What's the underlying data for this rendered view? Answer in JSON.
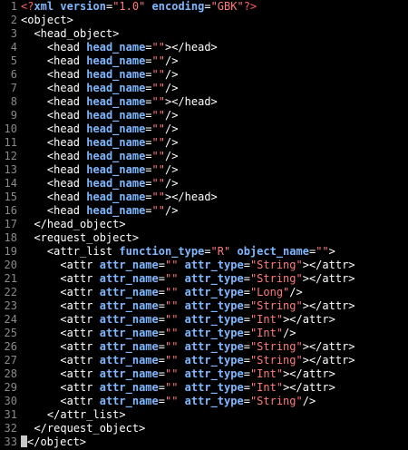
{
  "editor": {
    "lines": [
      {
        "n": "1",
        "indent": "",
        "tokens": [
          [
            "pi",
            "<?"
          ],
          [
            "attr",
            "xml"
          ],
          [
            "tag",
            " "
          ],
          [
            "attr",
            "version"
          ],
          [
            "eq",
            "="
          ],
          [
            "val",
            "\"1.0\""
          ],
          [
            "tag",
            " "
          ],
          [
            "attr",
            "encoding"
          ],
          [
            "eq",
            "="
          ],
          [
            "val",
            "\"GBK\""
          ],
          [
            "pi",
            "?>"
          ]
        ]
      },
      {
        "n": "2",
        "indent": "",
        "tokens": [
          [
            "tag",
            "<object>"
          ]
        ]
      },
      {
        "n": "3",
        "indent": "  ",
        "tokens": [
          [
            "tag",
            "<head_object>"
          ]
        ]
      },
      {
        "n": "4",
        "indent": "    ",
        "tokens": [
          [
            "tag",
            "<head "
          ],
          [
            "attr",
            "head_name"
          ],
          [
            "eq",
            "="
          ],
          [
            "val",
            "\"\""
          ],
          [
            "tag",
            "></head>"
          ]
        ]
      },
      {
        "n": "5",
        "indent": "    ",
        "tokens": [
          [
            "tag",
            "<head "
          ],
          [
            "attr",
            "head_name"
          ],
          [
            "eq",
            "="
          ],
          [
            "val",
            "\"\""
          ],
          [
            "tag",
            "/>"
          ]
        ]
      },
      {
        "n": "6",
        "indent": "    ",
        "tokens": [
          [
            "tag",
            "<head "
          ],
          [
            "attr",
            "head_name"
          ],
          [
            "eq",
            "="
          ],
          [
            "val",
            "\"\""
          ],
          [
            "tag",
            "/>"
          ]
        ]
      },
      {
        "n": "7",
        "indent": "    ",
        "tokens": [
          [
            "tag",
            "<head "
          ],
          [
            "attr",
            "head_name"
          ],
          [
            "eq",
            "="
          ],
          [
            "val",
            "\"\""
          ],
          [
            "tag",
            "/>"
          ]
        ]
      },
      {
        "n": "8",
        "indent": "    ",
        "tokens": [
          [
            "tag",
            "<head "
          ],
          [
            "attr",
            "head_name"
          ],
          [
            "eq",
            "="
          ],
          [
            "val",
            "\"\""
          ],
          [
            "tag",
            "></head>"
          ]
        ]
      },
      {
        "n": "9",
        "indent": "    ",
        "tokens": [
          [
            "tag",
            "<head "
          ],
          [
            "attr",
            "head_name"
          ],
          [
            "eq",
            "="
          ],
          [
            "val",
            "\"\""
          ],
          [
            "tag",
            "/>"
          ]
        ]
      },
      {
        "n": "10",
        "indent": "    ",
        "tokens": [
          [
            "tag",
            "<head "
          ],
          [
            "attr",
            "head_name"
          ],
          [
            "eq",
            "="
          ],
          [
            "val",
            "\"\""
          ],
          [
            "tag",
            "/>"
          ]
        ]
      },
      {
        "n": "11",
        "indent": "    ",
        "tokens": [
          [
            "tag",
            "<head "
          ],
          [
            "attr",
            "head_name"
          ],
          [
            "eq",
            "="
          ],
          [
            "val",
            "\"\""
          ],
          [
            "tag",
            "/>"
          ]
        ]
      },
      {
        "n": "12",
        "indent": "    ",
        "tokens": [
          [
            "tag",
            "<head "
          ],
          [
            "attr",
            "head_name"
          ],
          [
            "eq",
            "="
          ],
          [
            "val",
            "\"\""
          ],
          [
            "tag",
            "/>"
          ]
        ]
      },
      {
        "n": "13",
        "indent": "    ",
        "tokens": [
          [
            "tag",
            "<head "
          ],
          [
            "attr",
            "head_name"
          ],
          [
            "eq",
            "="
          ],
          [
            "val",
            "\"\""
          ],
          [
            "tag",
            "/>"
          ]
        ]
      },
      {
        "n": "14",
        "indent": "    ",
        "tokens": [
          [
            "tag",
            "<head "
          ],
          [
            "attr",
            "head_name"
          ],
          [
            "eq",
            "="
          ],
          [
            "val",
            "\"\""
          ],
          [
            "tag",
            "/>"
          ]
        ]
      },
      {
        "n": "15",
        "indent": "    ",
        "tokens": [
          [
            "tag",
            "<head "
          ],
          [
            "attr",
            "head_name"
          ],
          [
            "eq",
            "="
          ],
          [
            "val",
            "\"\""
          ],
          [
            "tag",
            "></head>"
          ]
        ]
      },
      {
        "n": "16",
        "indent": "    ",
        "tokens": [
          [
            "tag",
            "<head "
          ],
          [
            "attr",
            "head_name"
          ],
          [
            "eq",
            "="
          ],
          [
            "val",
            "\"\""
          ],
          [
            "tag",
            "/>"
          ]
        ]
      },
      {
        "n": "17",
        "indent": "  ",
        "tokens": [
          [
            "tag",
            "</head_object>"
          ]
        ]
      },
      {
        "n": "18",
        "indent": "  ",
        "tokens": [
          [
            "tag",
            "<request_object>"
          ]
        ]
      },
      {
        "n": "19",
        "indent": "    ",
        "tokens": [
          [
            "tag",
            "<attr_list "
          ],
          [
            "attr",
            "function_type"
          ],
          [
            "eq",
            "="
          ],
          [
            "val",
            "\"R\""
          ],
          [
            "tag",
            " "
          ],
          [
            "attr",
            "object_name"
          ],
          [
            "eq",
            "="
          ],
          [
            "val",
            "\"\""
          ],
          [
            "tag",
            ">"
          ]
        ]
      },
      {
        "n": "20",
        "indent": "      ",
        "tokens": [
          [
            "tag",
            "<attr "
          ],
          [
            "attr",
            "attr_name"
          ],
          [
            "eq",
            "="
          ],
          [
            "val",
            "\"\""
          ],
          [
            "tag",
            " "
          ],
          [
            "attr",
            "attr_type"
          ],
          [
            "eq",
            "="
          ],
          [
            "val",
            "\"String\""
          ],
          [
            "tag",
            "></attr>"
          ]
        ]
      },
      {
        "n": "21",
        "indent": "      ",
        "tokens": [
          [
            "tag",
            "<attr "
          ],
          [
            "attr",
            "attr_name"
          ],
          [
            "eq",
            "="
          ],
          [
            "val",
            "\"\""
          ],
          [
            "tag",
            " "
          ],
          [
            "attr",
            "attr_type"
          ],
          [
            "eq",
            "="
          ],
          [
            "val",
            "\"String\""
          ],
          [
            "tag",
            "></attr>"
          ]
        ]
      },
      {
        "n": "22",
        "indent": "      ",
        "tokens": [
          [
            "tag",
            "<attr "
          ],
          [
            "attr",
            "attr_name"
          ],
          [
            "eq",
            "="
          ],
          [
            "val",
            "\"\""
          ],
          [
            "tag",
            " "
          ],
          [
            "attr",
            "attr_type"
          ],
          [
            "eq",
            "="
          ],
          [
            "val",
            "\"Long\""
          ],
          [
            "tag",
            "/>"
          ]
        ]
      },
      {
        "n": "23",
        "indent": "      ",
        "tokens": [
          [
            "tag",
            "<attr "
          ],
          [
            "attr",
            "attr_name"
          ],
          [
            "eq",
            "="
          ],
          [
            "val",
            "\"\""
          ],
          [
            "tag",
            " "
          ],
          [
            "attr",
            "attr_type"
          ],
          [
            "eq",
            "="
          ],
          [
            "val",
            "\"String\""
          ],
          [
            "tag",
            "></attr>"
          ]
        ]
      },
      {
        "n": "24",
        "indent": "      ",
        "tokens": [
          [
            "tag",
            "<attr "
          ],
          [
            "attr",
            "attr_name"
          ],
          [
            "eq",
            "="
          ],
          [
            "val",
            "\"\""
          ],
          [
            "tag",
            " "
          ],
          [
            "attr",
            "attr_type"
          ],
          [
            "eq",
            "="
          ],
          [
            "val",
            "\"Int\""
          ],
          [
            "tag",
            "></attr>"
          ]
        ]
      },
      {
        "n": "25",
        "indent": "      ",
        "tokens": [
          [
            "tag",
            "<attr "
          ],
          [
            "attr",
            "attr_name"
          ],
          [
            "eq",
            "="
          ],
          [
            "val",
            "\"\""
          ],
          [
            "tag",
            " "
          ],
          [
            "attr",
            "attr_type"
          ],
          [
            "eq",
            "="
          ],
          [
            "val",
            "\"Int\""
          ],
          [
            "tag",
            "/>"
          ]
        ]
      },
      {
        "n": "26",
        "indent": "      ",
        "tokens": [
          [
            "tag",
            "<attr "
          ],
          [
            "attr",
            "attr_name"
          ],
          [
            "eq",
            "="
          ],
          [
            "val",
            "\"\""
          ],
          [
            "tag",
            " "
          ],
          [
            "attr",
            "attr_type"
          ],
          [
            "eq",
            "="
          ],
          [
            "val",
            "\"String\""
          ],
          [
            "tag",
            "></attr>"
          ]
        ]
      },
      {
        "n": "27",
        "indent": "      ",
        "tokens": [
          [
            "tag",
            "<attr "
          ],
          [
            "attr",
            "attr_name"
          ],
          [
            "eq",
            "="
          ],
          [
            "val",
            "\"\""
          ],
          [
            "tag",
            " "
          ],
          [
            "attr",
            "attr_type"
          ],
          [
            "eq",
            "="
          ],
          [
            "val",
            "\"String\""
          ],
          [
            "tag",
            "></attr>"
          ]
        ]
      },
      {
        "n": "28",
        "indent": "      ",
        "tokens": [
          [
            "tag",
            "<attr "
          ],
          [
            "attr",
            "attr_name"
          ],
          [
            "eq",
            "="
          ],
          [
            "val",
            "\"\""
          ],
          [
            "tag",
            " "
          ],
          [
            "attr",
            "attr_type"
          ],
          [
            "eq",
            "="
          ],
          [
            "val",
            "\"Int\""
          ],
          [
            "tag",
            "></attr>"
          ]
        ]
      },
      {
        "n": "29",
        "indent": "      ",
        "tokens": [
          [
            "tag",
            "<attr "
          ],
          [
            "attr",
            "attr_name"
          ],
          [
            "eq",
            "="
          ],
          [
            "val",
            "\"\""
          ],
          [
            "tag",
            " "
          ],
          [
            "attr",
            "attr_type"
          ],
          [
            "eq",
            "="
          ],
          [
            "val",
            "\"Int\""
          ],
          [
            "tag",
            "></attr>"
          ]
        ]
      },
      {
        "n": "30",
        "indent": "      ",
        "tokens": [
          [
            "tag",
            "<attr "
          ],
          [
            "attr",
            "attr_name"
          ],
          [
            "eq",
            "="
          ],
          [
            "val",
            "\"\""
          ],
          [
            "tag",
            " "
          ],
          [
            "attr",
            "attr_type"
          ],
          [
            "eq",
            "="
          ],
          [
            "val",
            "\"String\""
          ],
          [
            "tag",
            "/>"
          ]
        ]
      },
      {
        "n": "31",
        "indent": "    ",
        "tokens": [
          [
            "tag",
            "</attr_list>"
          ]
        ]
      },
      {
        "n": "32",
        "indent": "  ",
        "tokens": [
          [
            "tag",
            "</request_object>"
          ]
        ]
      },
      {
        "n": "33",
        "indent": "",
        "tokens": [
          [
            "tag",
            "</object>"
          ]
        ]
      }
    ],
    "colors": {
      "background": "#000000",
      "line_number": "#8a8a8a",
      "tag": "#ffffff",
      "attribute": "#7fb8ff",
      "value": "#ff7b7b",
      "processing_instruction": "#ff6060"
    }
  }
}
